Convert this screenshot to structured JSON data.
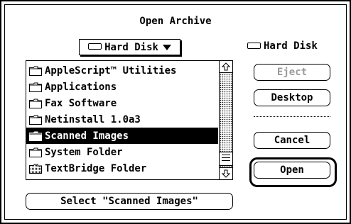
{
  "dialog": {
    "title": "Open Archive"
  },
  "location_popup": {
    "label": "Hard Disk",
    "icon": "disk-icon"
  },
  "volume": {
    "label": "Hard Disk",
    "icon": "disk-icon"
  },
  "file_list": {
    "items": [
      {
        "label": "AppleScript™ Utilities",
        "icon": "folder-icon",
        "selected": false
      },
      {
        "label": "Applications",
        "icon": "folder-icon",
        "selected": false
      },
      {
        "label": "Fax Software",
        "icon": "folder-icon",
        "selected": false
      },
      {
        "label": "Netinstall 1.0a3",
        "icon": "folder-icon",
        "selected": false
      },
      {
        "label": "Scanned Images",
        "icon": "folder-icon",
        "selected": true
      },
      {
        "label": "System Folder",
        "icon": "folder-icon",
        "selected": false
      },
      {
        "label": "TextBridge Folder",
        "icon": "shared-folder-icon",
        "selected": false
      }
    ]
  },
  "buttons": {
    "eject": "Eject",
    "desktop": "Desktop",
    "cancel": "Cancel",
    "open": "Open",
    "select": "Select \"Scanned Images\""
  }
}
